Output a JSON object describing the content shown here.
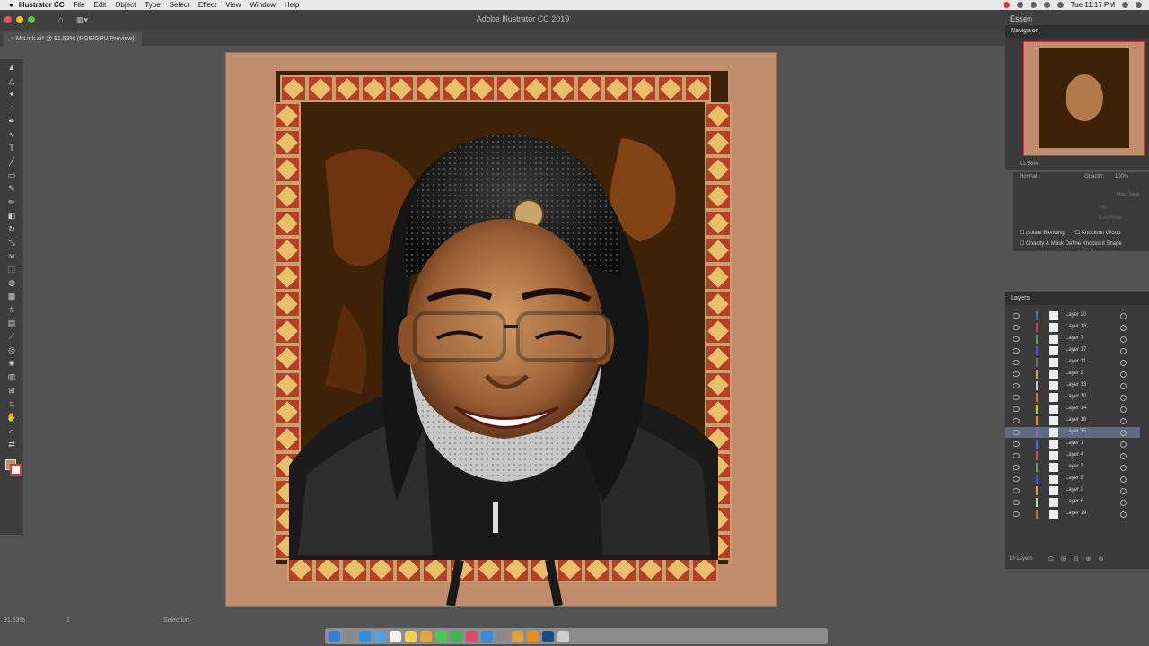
{
  "menubar": {
    "app_name": "Illustrator CC",
    "items": [
      "File",
      "Edit",
      "Object",
      "Type",
      "Select",
      "Effect",
      "View",
      "Window",
      "Help"
    ],
    "clock": "Tue 11:17 PM"
  },
  "window": {
    "title": "Adobe Illustrator CC 2019",
    "workspace": "Essen"
  },
  "document": {
    "tab_label": "MrLink.ai* @ 91.53% (RGB/GPU Preview)"
  },
  "status": {
    "zoom": "91.53%",
    "page": "1",
    "tool": "Selection"
  },
  "navigator": {
    "title": "Navigator",
    "zoom": "91.53%"
  },
  "transparency": {
    "blend_mode": "Normal",
    "opacity_label": "Opacity:",
    "opacity_value": "100%",
    "make_mask": "Make Mask",
    "clip": "Clip",
    "invert_mask": "Invert Mask",
    "isolate_blending": "Isolate Blending",
    "knockout_group": "Knockout Group",
    "opacity_mask": "Opacity & Mask Define Knockout Shape"
  },
  "layers": {
    "title": "Layers",
    "count_label": "18 Layers",
    "items": [
      {
        "name": "Layer 20",
        "color": "#4a6cd6"
      },
      {
        "name": "Layer 18",
        "color": "#d63a3a"
      },
      {
        "name": "Layer 7",
        "color": "#3ab54a"
      },
      {
        "name": "Layer 17",
        "color": "#3a5bd6"
      },
      {
        "name": "Layer 11",
        "color": "#6a6a6a"
      },
      {
        "name": "Layer 9",
        "color": "#d6a63a"
      },
      {
        "name": "Layer 13",
        "color": "#c8c8c8"
      },
      {
        "name": "Layer 10",
        "color": "#d66a3a"
      },
      {
        "name": "Layer 14",
        "color": "#d6c23a"
      },
      {
        "name": "Layer 16",
        "color": "#e08a2a"
      },
      {
        "name": "Layer 15",
        "color": "#b84ad6",
        "selected": true
      },
      {
        "name": "Layer 1",
        "color": "#4a6cd6"
      },
      {
        "name": "Layer 4",
        "color": "#d64a4a"
      },
      {
        "name": "Layer 3",
        "color": "#3ab54a"
      },
      {
        "name": "Layer 8",
        "color": "#3a5bd6"
      },
      {
        "name": "Layer 2",
        "color": "#d6a63a"
      },
      {
        "name": "Layer 6",
        "color": "#c8c8c8"
      },
      {
        "name": "Layer 19",
        "color": "#d66a3a"
      }
    ]
  },
  "dock": {
    "icons": [
      "finder-icon",
      "launchpad-icon",
      "safari-icon",
      "mail-icon",
      "calendar-icon",
      "notes-icon",
      "photos-icon",
      "messages-icon",
      "facetime-icon",
      "music-icon",
      "appstore-icon",
      "settings-icon",
      "chrome-icon",
      "illustrator-icon",
      "photoshop-icon",
      "trash-icon"
    ],
    "colors": [
      "#3a7bd5",
      "#8a8a8a",
      "#2b8fe0",
      "#4aa3e8",
      "#f2f2f2",
      "#f2d24a",
      "#e8a23a",
      "#4ac84a",
      "#3ab84a",
      "#e04a6a",
      "#3a8ae0",
      "#8a8a8a",
      "#e0a23a",
      "#f28a1a",
      "#1a4a8a",
      "#cccccc"
    ]
  },
  "accent_colors": {
    "panel_selection": "#5f6b82",
    "artboard_bg": "#c08e6e",
    "frame_dark": "#3d2208",
    "tile_red": "#b5402a",
    "tile_gold": "#e8c06a"
  }
}
